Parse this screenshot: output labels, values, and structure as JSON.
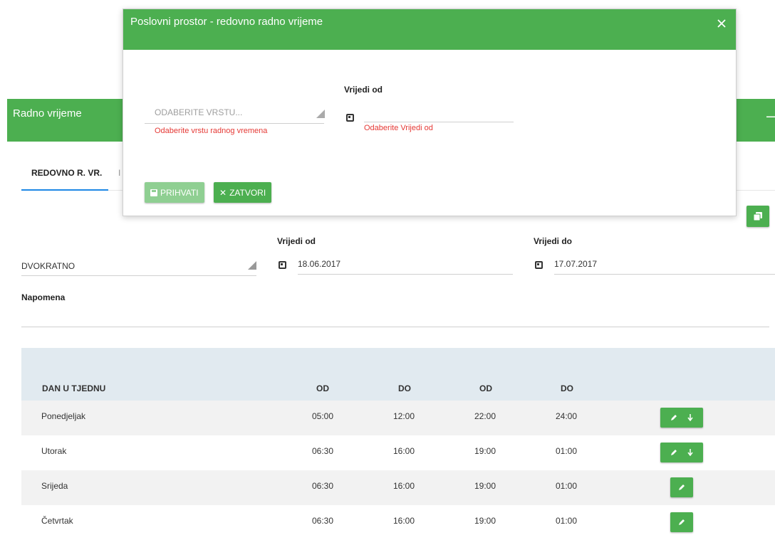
{
  "modal": {
    "title": "Poslovni prostor - redovno radno vrijeme",
    "type_placeholder": "ODABERITE VRSTU...",
    "type_error": "Odaberite vrstu radnog vremena",
    "valid_from_label": "Vrijedi od",
    "valid_from_error": "Odaberite Vrijedi od",
    "accept_label": "PRIHVATI",
    "close_label": "ZATVORI"
  },
  "panel": {
    "title": "Radno vrijeme",
    "tabs": [
      "REDOVNO R. VR.",
      "I"
    ]
  },
  "form": {
    "type_value": "DVOKRATNO",
    "valid_from_label": "Vrijedi od",
    "valid_from_value": "18.06.2017",
    "valid_to_label": "Vrijedi do",
    "valid_to_value": "17.07.2017",
    "note_label": "Napomena"
  },
  "table": {
    "headers": [
      "DAN U TJEDNU",
      "OD",
      "DO",
      "OD",
      "DO"
    ],
    "rows": [
      {
        "day": "Ponedjeljak",
        "od1": "05:00",
        "do1": "12:00",
        "od2": "22:00",
        "do2": "24:00",
        "actions": [
          "edit",
          "down"
        ]
      },
      {
        "day": "Utorak",
        "od1": "06:30",
        "do1": "16:00",
        "od2": "19:00",
        "do2": "01:00",
        "actions": [
          "edit",
          "down"
        ]
      },
      {
        "day": "Srijeda",
        "od1": "06:30",
        "do1": "16:00",
        "od2": "19:00",
        "do2": "01:00",
        "actions": [
          "edit"
        ]
      },
      {
        "day": "Četvrtak",
        "od1": "06:30",
        "do1": "16:00",
        "od2": "19:00",
        "do2": "01:00",
        "actions": [
          "edit"
        ]
      }
    ]
  },
  "colors": {
    "accent": "#4caf50",
    "error": "#e53935",
    "tab_underline": "#1e88e5"
  }
}
